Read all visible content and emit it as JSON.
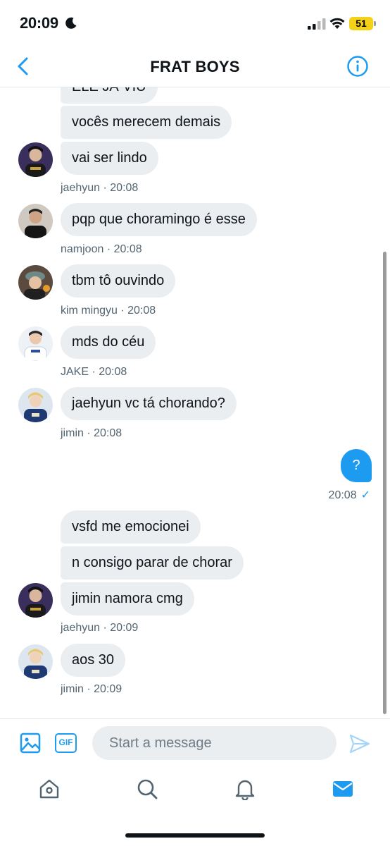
{
  "status_bar": {
    "time": "20:09",
    "battery": "51"
  },
  "header": {
    "title": "FRAT BOYS"
  },
  "messages": [
    {
      "text": "ELE JÁ VIU"
    },
    {
      "text": "vocês merecem demais"
    },
    {
      "text": "vai ser lindo"
    },
    {
      "meta": "jaehyun · 20:08"
    },
    {
      "text": "pqp que choramingo é esse"
    },
    {
      "meta": "namjoon  · 20:08"
    },
    {
      "text": "tbm tô ouvindo"
    },
    {
      "meta": "kim mingyu · 20:08"
    },
    {
      "text": "mds do céu"
    },
    {
      "meta": "JAKE · 20:08"
    },
    {
      "text": "jaehyun vc tá chorando?"
    },
    {
      "meta": "jimin  · 20:08"
    },
    {
      "text": "vsfd me emocionei"
    },
    {
      "text": "n consigo parar de chorar"
    },
    {
      "text": "jimin namora cmg"
    },
    {
      "meta": "jaehyun · 20:09"
    },
    {
      "text": "aos 30"
    },
    {
      "meta": "jimin  · 20:09"
    }
  ],
  "sent": {
    "text": "?",
    "time": "20:08"
  },
  "composer": {
    "placeholder": "Start a message",
    "gif_label": "GIF"
  },
  "colors": {
    "accent": "#1d9bf0",
    "bubble": "#ebeef0",
    "meta": "#536471"
  },
  "icons": [
    "back-chevron-icon",
    "info-icon",
    "image-icon",
    "gif-icon",
    "send-icon",
    "home-icon",
    "search-icon",
    "bell-icon",
    "mail-icon"
  ]
}
